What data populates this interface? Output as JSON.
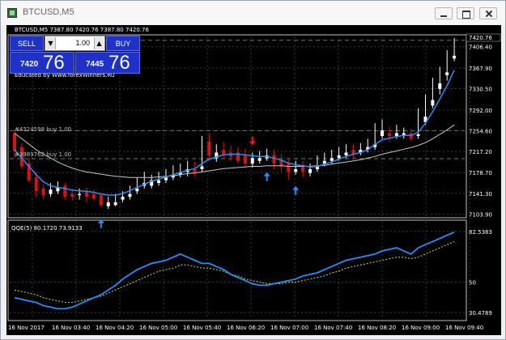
{
  "window": {
    "title": "BTCUSD,M5"
  },
  "chart": {
    "header": "BTCUSD,M5  7387.80 7420.76 7387.80 7420.76",
    "educated": "Educated by Www.forexWinners.Ru",
    "order1": "#4324598 buy 1.00",
    "order2": "#3989762 buy 1.00",
    "price_labels": [
      "7420.76",
      "7406.40",
      "7367.90",
      "7330.50",
      "7292.00",
      "7254.60",
      "7217.20",
      "7178.70",
      "7141.30",
      "7103.90"
    ],
    "current_price": "7420.76",
    "indicator_title": "QQE(5) 80.1720 73.9133",
    "indicator_labels": [
      "82.5383",
      "50",
      "30.4789"
    ],
    "time_labels": [
      "16 Nov 2017",
      "16 Nov 03:40",
      "16 Nov 04:20",
      "16 Nov 05:00",
      "16 Nov 05:40",
      "16 Nov 06:20",
      "16 Nov 07:00",
      "16 Nov 07:40",
      "16 Nov 08:20",
      "16 Nov 09:00",
      "16 Nov 09:40"
    ]
  },
  "trade_panel": {
    "sell_label": "SELL",
    "buy_label": "BUY",
    "lots": "1.00",
    "sell_price_small": "7420",
    "sell_price_big": "76",
    "buy_price_small": "7445",
    "buy_price_big": "76"
  },
  "colors": {
    "bull": "#ffffff",
    "bear": "#e01010",
    "ma_blue": "#1e90ff",
    "ma_gray": "#c8c8c8",
    "grid": "#2c3f2c",
    "qqe_fast": "#1e90ff",
    "qqe_slow": "#e0e000",
    "arrow_up": "#1e90ff",
    "arrow_down": "#ff1010"
  },
  "candles": [
    [
      7250,
      7256,
      7218,
      7205,
      1
    ],
    [
      7225,
      7232,
      7190,
      7185,
      1
    ],
    [
      7195,
      7205,
      7165,
      7160,
      1
    ],
    [
      7170,
      7180,
      7145,
      7135,
      1
    ],
    [
      7150,
      7158,
      7138,
      7130,
      1
    ],
    [
      7148,
      7160,
      7140,
      7135,
      0
    ],
    [
      7152,
      7163,
      7145,
      7140,
      0
    ],
    [
      7155,
      7160,
      7135,
      7130,
      1
    ],
    [
      7140,
      7150,
      7135,
      7128,
      1
    ],
    [
      7140,
      7150,
      7138,
      7130,
      0
    ],
    [
      7145,
      7152,
      7135,
      7125,
      1
    ],
    [
      7140,
      7148,
      7132,
      7128,
      1
    ],
    [
      7138,
      7143,
      7120,
      7115,
      1
    ],
    [
      7125,
      7135,
      7118,
      7113,
      0
    ],
    [
      7125,
      7140,
      7120,
      7118,
      0
    ],
    [
      7135,
      7145,
      7130,
      7125,
      0
    ],
    [
      7140,
      7155,
      7135,
      7130,
      0
    ],
    [
      7150,
      7170,
      7145,
      7140,
      0
    ],
    [
      7160,
      7180,
      7155,
      7150,
      0
    ],
    [
      7165,
      7175,
      7155,
      7150,
      0
    ],
    [
      7165,
      7180,
      7160,
      7155,
      0
    ],
    [
      7170,
      7185,
      7165,
      7160,
      0
    ],
    [
      7175,
      7192,
      7170,
      7165,
      0
    ],
    [
      7180,
      7195,
      7175,
      7170,
      0
    ],
    [
      7185,
      7200,
      7180,
      7172,
      0
    ],
    [
      7185,
      7198,
      7178,
      7172,
      1
    ],
    [
      7190,
      7245,
      7185,
      7180,
      0
    ],
    [
      7235,
      7250,
      7210,
      7200,
      1
    ],
    [
      7215,
      7230,
      7205,
      7198,
      0
    ],
    [
      7220,
      7235,
      7210,
      7205,
      1
    ],
    [
      7215,
      7228,
      7208,
      7200,
      1
    ],
    [
      7215,
      7225,
      7200,
      7195,
      1
    ],
    [
      7210,
      7222,
      7195,
      7190,
      1
    ],
    [
      7205,
      7215,
      7195,
      7188,
      0
    ],
    [
      7205,
      7218,
      7200,
      7195,
      0
    ],
    [
      7210,
      7222,
      7205,
      7200,
      0
    ],
    [
      7210,
      7220,
      7195,
      7185,
      1
    ],
    [
      7200,
      7212,
      7190,
      7180,
      1
    ],
    [
      7195,
      7205,
      7180,
      7165,
      1
    ],
    [
      7185,
      7200,
      7180,
      7175,
      0
    ],
    [
      7190,
      7200,
      7180,
      7170,
      1
    ],
    [
      7185,
      7195,
      7178,
      7172,
      0
    ],
    [
      7190,
      7210,
      7185,
      7180,
      0
    ],
    [
      7200,
      7215,
      7195,
      7190,
      0
    ],
    [
      7205,
      7220,
      7200,
      7195,
      0
    ],
    [
      7210,
      7225,
      7205,
      7200,
      0
    ],
    [
      7215,
      7230,
      7210,
      7205,
      0
    ],
    [
      7220,
      7230,
      7212,
      7205,
      1
    ],
    [
      7220,
      7232,
      7215,
      7210,
      0
    ],
    [
      7225,
      7240,
      7220,
      7215,
      0
    ],
    [
      7230,
      7268,
      7225,
      7220,
      0
    ],
    [
      7255,
      7275,
      7245,
      7240,
      0
    ],
    [
      7250,
      7262,
      7245,
      7235,
      1
    ],
    [
      7250,
      7265,
      7245,
      7240,
      0
    ],
    [
      7250,
      7260,
      7245,
      7240,
      0
    ],
    [
      7250,
      7258,
      7240,
      7235,
      1
    ],
    [
      7248,
      7295,
      7245,
      7240,
      0
    ],
    [
      7280,
      7320,
      7270,
      7265,
      0
    ],
    [
      7310,
      7350,
      7300,
      7295,
      0
    ],
    [
      7340,
      7370,
      7330,
      7320,
      0
    ],
    [
      7360,
      7400,
      7355,
      7345,
      0
    ],
    [
      7390,
      7422,
      7385,
      7380,
      0
    ]
  ],
  "ma_fast": [
    7220,
    7205,
    7190,
    7175,
    7162,
    7155,
    7152,
    7150,
    7147,
    7146,
    7145,
    7143,
    7140,
    7138,
    7138,
    7141,
    7146,
    7152,
    7158,
    7163,
    7167,
    7171,
    7175,
    7179,
    7183,
    7186,
    7195,
    7203,
    7207,
    7211,
    7212,
    7212,
    7211,
    7209,
    7208,
    7208,
    7205,
    7201,
    7196,
    7193,
    7191,
    7189,
    7190,
    7194,
    7198,
    7203,
    7208,
    7212,
    7215,
    7220,
    7230,
    7238,
    7241,
    7244,
    7246,
    7246,
    7252,
    7268,
    7289,
    7312,
    7336,
    7364
  ],
  "ma_slow": [
    7250,
    7240,
    7230,
    7220,
    7212,
    7205,
    7198,
    7192,
    7187,
    7183,
    7180,
    7178,
    7176,
    7174,
    7172,
    7171,
    7170,
    7170,
    7170,
    7170,
    7171,
    7172,
    7173,
    7175,
    7177,
    7178,
    7180,
    7182,
    7184,
    7186,
    7187,
    7188,
    7189,
    7190,
    7190,
    7191,
    7191,
    7191,
    7190,
    7190,
    7190,
    7190,
    7191,
    7192,
    7194,
    7196,
    7198,
    7200,
    7202,
    7205,
    7208,
    7212,
    7215,
    7218,
    7221,
    7224,
    7228,
    7233,
    7240,
    7248,
    7256,
    7265
  ],
  "qqe_fast": [
    40,
    39,
    38,
    37,
    35,
    34,
    33,
    33,
    34,
    36,
    38,
    40,
    42,
    45,
    48,
    52,
    55,
    58,
    60,
    62,
    63,
    64,
    66,
    68,
    66,
    64,
    62,
    62,
    60,
    58,
    55,
    53,
    51,
    49,
    48,
    48,
    49,
    50,
    51,
    52,
    54,
    55,
    56,
    58,
    60,
    62,
    64,
    65,
    66,
    67,
    68,
    70,
    71,
    72,
    70,
    68,
    72,
    74,
    76,
    78,
    80,
    82
  ],
  "qqe_slow": [
    45,
    44,
    43,
    42,
    40,
    39,
    38,
    37,
    37,
    38,
    39,
    40,
    41,
    43,
    45,
    47,
    49,
    51,
    53,
    55,
    57,
    58,
    59,
    61,
    61,
    60,
    59,
    59,
    58,
    57,
    55,
    54,
    52,
    51,
    50,
    49,
    49,
    49,
    50,
    50,
    51,
    52,
    53,
    54,
    56,
    57,
    59,
    60,
    61,
    62,
    63,
    64,
    65,
    66,
    66,
    65,
    66,
    68,
    70,
    72,
    74,
    76
  ],
  "arrows_up": [
    12,
    35,
    39
  ],
  "arrows_down": [
    33
  ]
}
